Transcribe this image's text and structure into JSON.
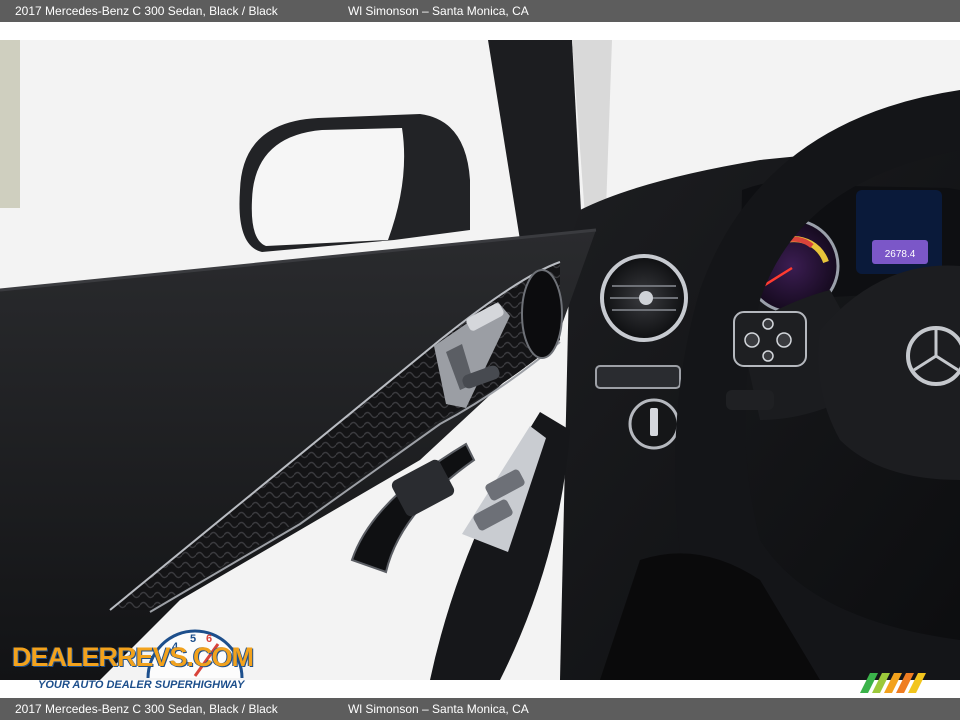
{
  "caption": {
    "title": "2017 Mercedes-Benz C 300 Sedan,  Black / Black",
    "dealer": "Wl Simonson – Santa Monica, CA"
  },
  "photo": {
    "subject": "driver-side door panel and steering wheel interior",
    "dash_screen_text": "2678.4"
  },
  "watermark": {
    "brand": "DealerRevs.com",
    "brand_display": "DEALERREVS.COM",
    "tagline": "YOUR AUTO DEALER SUPERHIGHWAY",
    "colors": {
      "primary": "#1d4f8c",
      "accent": "#f2a21d"
    }
  },
  "colors": {
    "caption_bar": "#5d5d5d",
    "caption_text": "#ffffff"
  }
}
